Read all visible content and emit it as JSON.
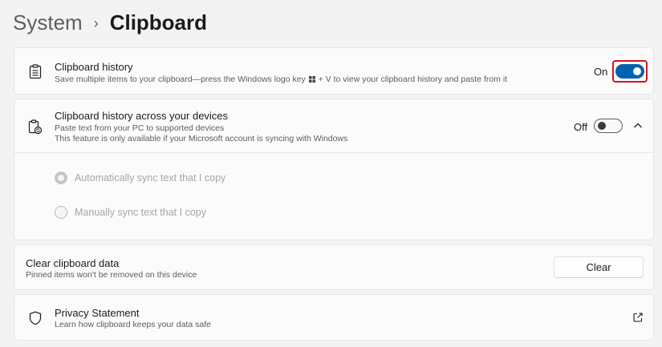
{
  "breadcrumb": {
    "parent": "System",
    "separator": "›",
    "current": "Clipboard"
  },
  "clipboard_history": {
    "title": "Clipboard history",
    "description_before": "Save multiple items to your clipboard—press the Windows logo key",
    "description_after": "+ V to view your clipboard history and paste from it",
    "toggle_state": "On",
    "toggle_on": true,
    "icon": "clipboard-icon"
  },
  "clipboard_sync": {
    "title": "Clipboard history across your devices",
    "description_line1": "Paste text from your PC to supported devices",
    "description_line2": "This feature is only available if your Microsoft account is syncing with Windows",
    "toggle_state": "Off",
    "toggle_on": false,
    "icon": "clipboard-sync-icon",
    "expand_icon": "chevron-up-icon",
    "options": [
      {
        "label": "Automatically sync text that I copy",
        "checked": true
      },
      {
        "label": "Manually sync text that I copy",
        "checked": false
      }
    ]
  },
  "clear_data": {
    "title": "Clear clipboard data",
    "description": "Pinned items won't be removed on this device",
    "button_label": "Clear"
  },
  "privacy": {
    "title": "Privacy Statement",
    "description": "Learn how clipboard keeps your data safe",
    "icon": "shield-icon",
    "link_icon": "external-link-icon"
  },
  "colors": {
    "accent": "#0063b1",
    "highlight": "#d6141b",
    "background": "#f3f3f3"
  }
}
